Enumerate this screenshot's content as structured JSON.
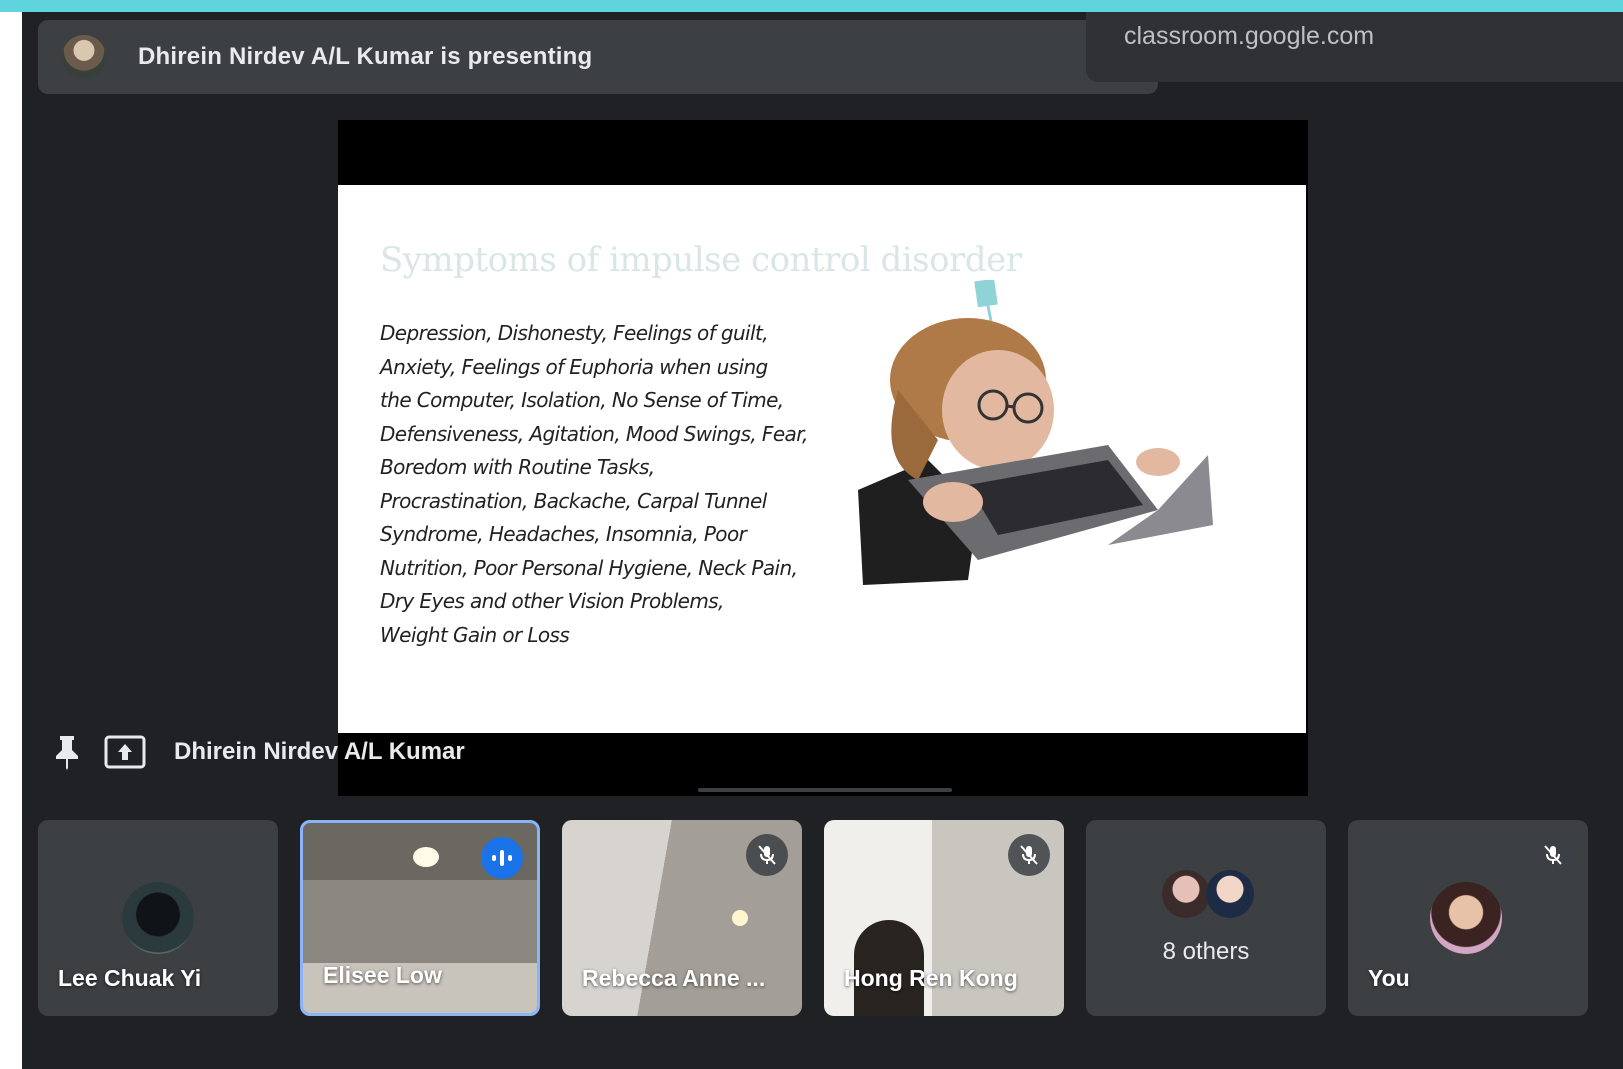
{
  "presenting_bar": {
    "text": "Dhirein Nirdev A/L Kumar is presenting"
  },
  "url": "classroom.google.com",
  "slide": {
    "title": "Symptoms of impulse control disorder",
    "lines": [
      "Depression, Dishonesty, Feelings of guilt,",
      "Anxiety, Feelings of Euphoria when using",
      "the Computer, Isolation, No Sense of Time,",
      "Defensiveness, Agitation, Mood Swings, Fear,",
      "Boredom with Routine Tasks,",
      "Procrastination, Backache, Carpal Tunnel",
      "Syndrome, Headaches, Insomnia, Poor",
      "Nutrition, Poor Personal Hygiene, Neck Pain,",
      "Dry Eyes and other Vision Problems,",
      "Weight Gain or Loss"
    ]
  },
  "presenter_label": "Dhirein Nirdev A/L Kumar",
  "participants": [
    {
      "name": "Lee Chuak Yi"
    },
    {
      "name": "Elisee Low"
    },
    {
      "name": "Rebecca Anne ..."
    },
    {
      "name": "Hong Ren Kong"
    },
    {
      "name": "8 others"
    },
    {
      "name": "You"
    }
  ],
  "colors": {
    "accent": "#1a73e8",
    "background": "#202124",
    "tile": "#3c4043",
    "active_border": "#8ab4f8"
  },
  "icons": [
    "pin-icon",
    "present-screen-icon",
    "mic-off-icon",
    "speaking-indicator-icon"
  ]
}
